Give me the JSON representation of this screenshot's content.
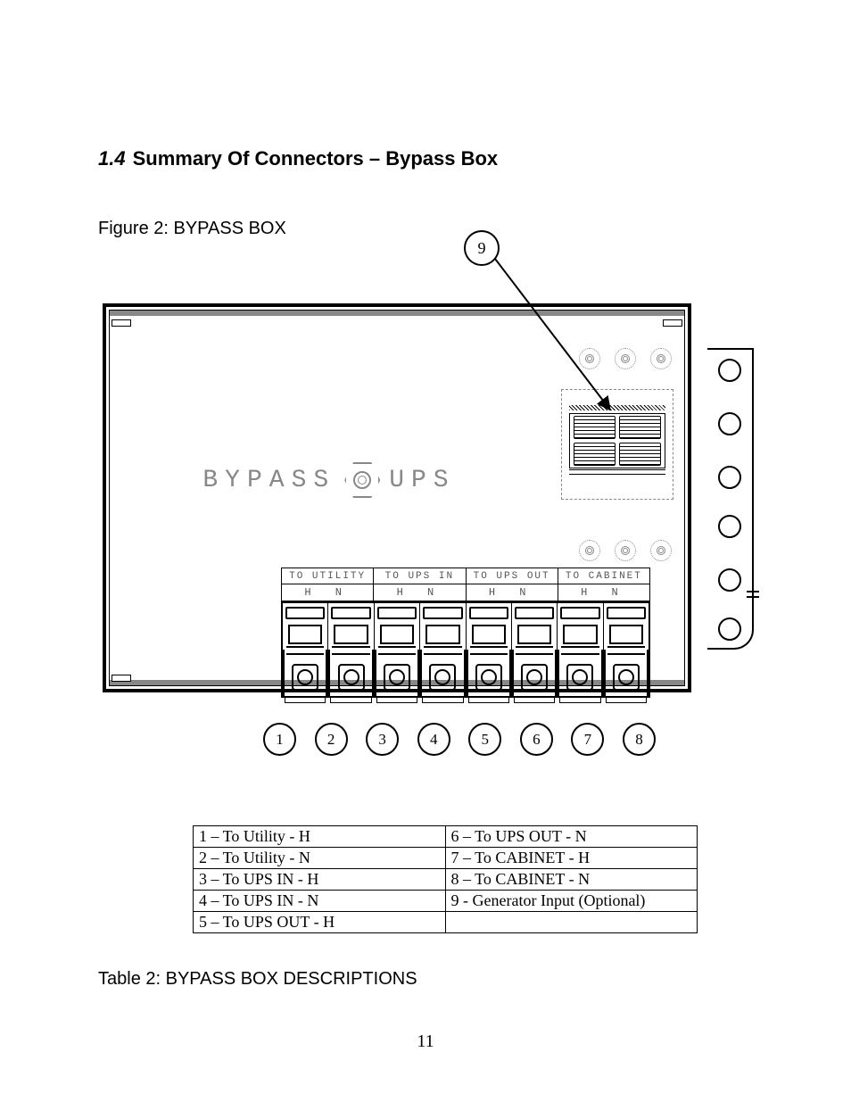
{
  "heading": {
    "number": "1.4",
    "title": "Summary Of Connectors – Bypass Box"
  },
  "figure_caption": "Figure 2: BYPASS BOX",
  "center_label_left": "BYPASS",
  "center_label_right": "UPS",
  "terminal_block": {
    "group_labels": [
      "TO UTILITY",
      "TO UPS IN",
      "TO UPS OUT",
      "TO CABINET"
    ],
    "hn_labels": [
      "H  N",
      "H  N",
      "H  N",
      "H  N"
    ]
  },
  "callouts_bottom": [
    "1",
    "2",
    "3",
    "4",
    "5",
    "6",
    "7",
    "8"
  ],
  "callout_top": "9",
  "key_table": [
    [
      "1 – To Utility - H",
      "6 – To UPS OUT - N"
    ],
    [
      "2 – To Utility - N",
      "7 – To CABINET - H"
    ],
    [
      "3 – To UPS IN - H",
      "8 – To CABINET - N"
    ],
    [
      "4 – To UPS IN - N",
      "9 - Generator Input (Optional)"
    ],
    [
      "5 – To UPS OUT - H",
      ""
    ]
  ],
  "table_caption": "Table 2: BYPASS BOX DESCRIPTIONS",
  "page_number": "11"
}
